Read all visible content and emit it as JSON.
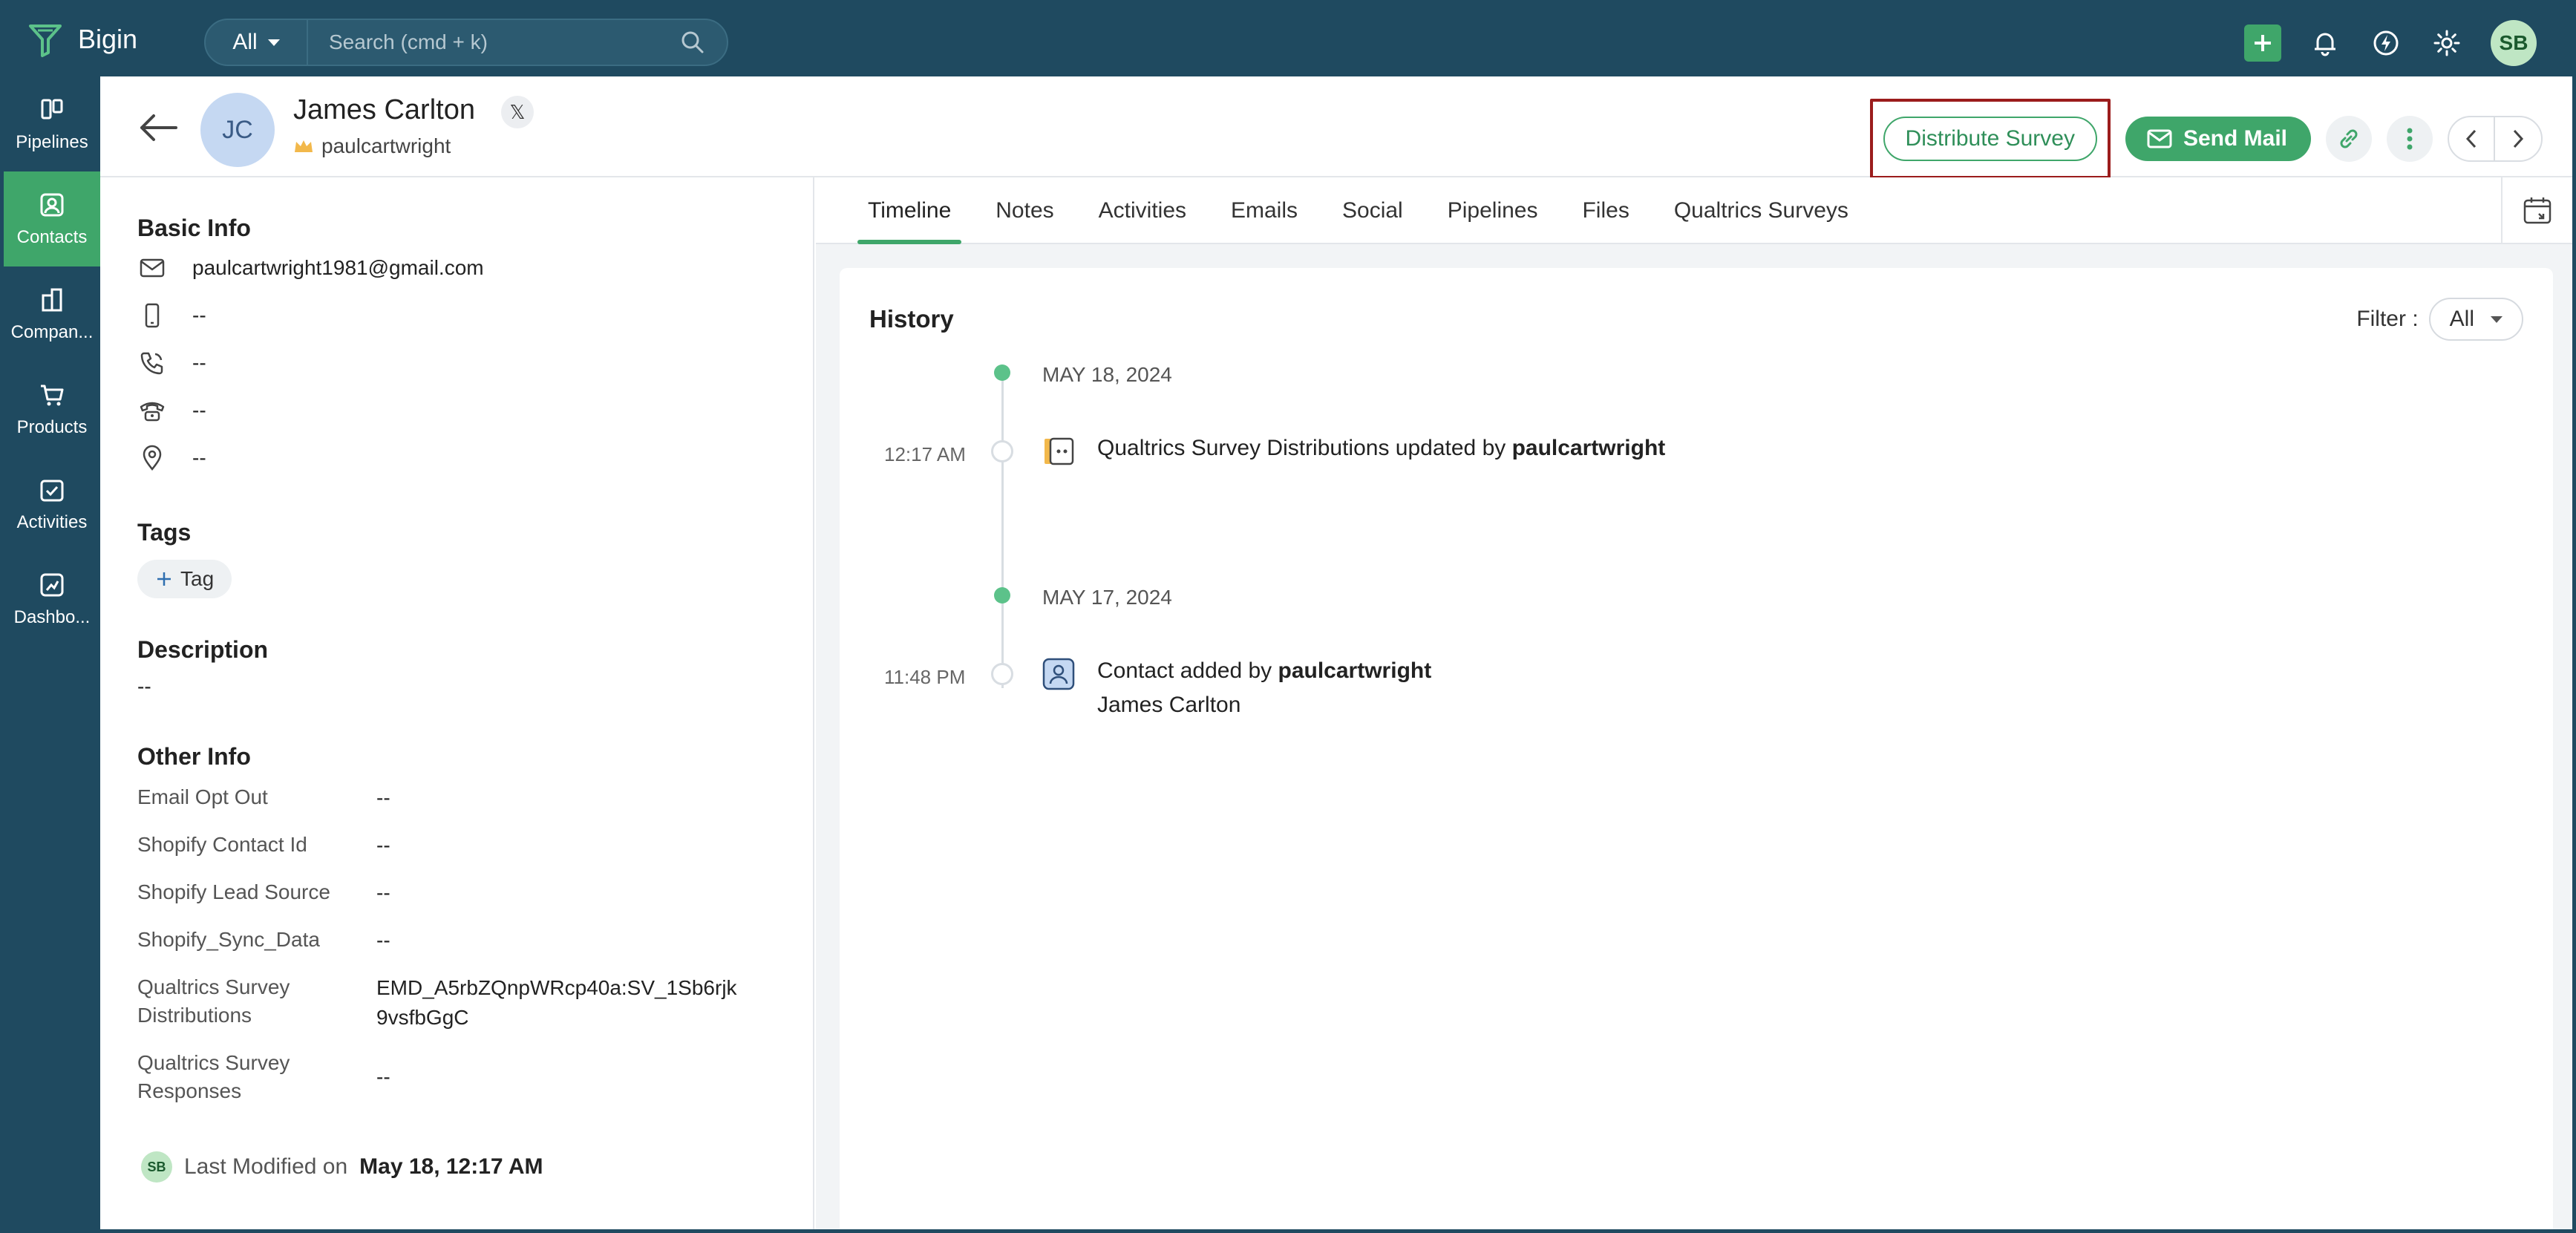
{
  "app": {
    "name": "Bigin"
  },
  "search": {
    "scope": "All",
    "placeholder": "Search (cmd + k)"
  },
  "top_avatar": "SB",
  "nav": [
    {
      "label": "Pipelines",
      "icon": "pipelines-icon"
    },
    {
      "label": "Contacts",
      "icon": "contacts-icon",
      "active": true
    },
    {
      "label": "Compan...",
      "icon": "companies-icon"
    },
    {
      "label": "Products",
      "icon": "products-icon"
    },
    {
      "label": "Activities",
      "icon": "activities-icon"
    },
    {
      "label": "Dashbo...",
      "icon": "dashboards-icon"
    }
  ],
  "contact": {
    "initials": "JC",
    "name": "James Carlton",
    "owner": "paulcartwright",
    "social_badge": "𝕏"
  },
  "actions": {
    "distribute_survey": "Distribute Survey",
    "send_mail": "Send Mail"
  },
  "basic_info": {
    "title": "Basic Info",
    "email": "paulcartwright1981@gmail.com",
    "mobile": "--",
    "phone": "--",
    "home_phone": "--",
    "address": "--"
  },
  "tags": {
    "title": "Tags",
    "add_label": "Tag"
  },
  "description": {
    "title": "Description",
    "value": "--"
  },
  "other_info": {
    "title": "Other Info",
    "fields": [
      {
        "key": "Email Opt Out",
        "value": "--"
      },
      {
        "key": "Shopify Contact Id",
        "value": "--"
      },
      {
        "key": "Shopify Lead Source",
        "value": "--"
      },
      {
        "key": "Shopify_Sync_Data",
        "value": "--"
      },
      {
        "key": "Qualtrics Survey Distributions",
        "value": "EMD_A5rbZQnpWRcp40a:SV_1Sb6rjk9vsfbGgC"
      },
      {
        "key": "Qualtrics Survey Responses",
        "value": "--"
      }
    ]
  },
  "last_modified": {
    "initials": "SB",
    "label": "Last Modified on",
    "value": "May 18, 12:17 AM"
  },
  "tabs": [
    "Timeline",
    "Notes",
    "Activities",
    "Emails",
    "Social",
    "Pipelines",
    "Files",
    "Qualtrics Surveys"
  ],
  "history": {
    "title": "History",
    "filter_label": "Filter :",
    "filter_value": "All",
    "groups": [
      {
        "date": "MAY 18, 2024",
        "time": "12:17 AM",
        "text": "Qualtrics Survey Distributions updated by ",
        "user": "paulcartwright"
      },
      {
        "date": "MAY 17, 2024",
        "time": "11:48 PM",
        "text": "Contact added by ",
        "user": "paulcartwright",
        "subtext": "James Carlton"
      }
    ]
  }
}
